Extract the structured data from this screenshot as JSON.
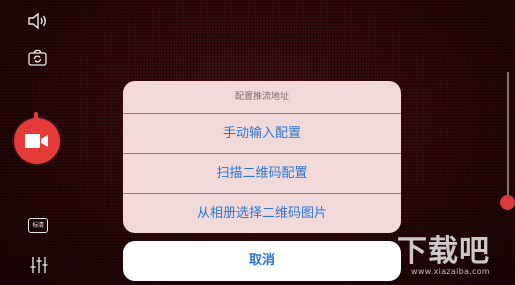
{
  "left_controls": {
    "speaker_icon": "speaker-icon",
    "camera_flip_icon": "camera-switch-icon",
    "record_icon": "video-camera-icon",
    "quality_label": "标清",
    "mixer_icon": "sliders-icon"
  },
  "action_sheet": {
    "title": "配置推流地址",
    "options": [
      "手动输入配置",
      "扫描二维码配置",
      "从相册选择二维码图片"
    ],
    "cancel": "取消"
  },
  "watermark": {
    "logo": "下载吧",
    "url": "www.xiazaiba.com"
  },
  "colors": {
    "accent": "#2b77d6",
    "record": "#e53a3a",
    "sheet_bg": "#f1d8d9",
    "divider": "#b07377"
  }
}
